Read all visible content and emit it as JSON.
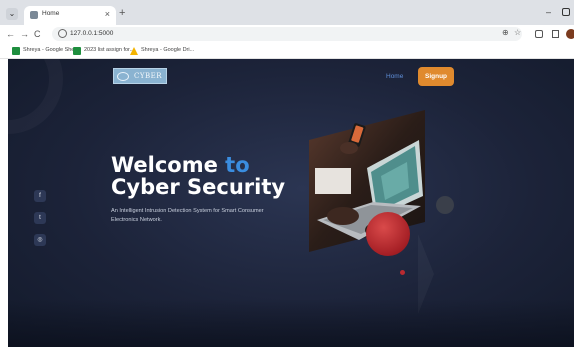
{
  "browser": {
    "tab_title": "Home",
    "tab_close": "×",
    "new_tab": "+",
    "minimize": "–",
    "url": "127.0.0.1:5000",
    "back": "←",
    "forward": "→",
    "reload": "C",
    "zoom": "⊕",
    "star": "☆",
    "bookmarks": [
      {
        "label": "Shreya - Google She...",
        "icon_color": "#1e8e3e"
      },
      {
        "label": "2023 list assign for...",
        "icon_color": "#1e8e3e"
      },
      {
        "label": "Shreya - Google Dri...",
        "icon_color": "#f4b400"
      }
    ]
  },
  "site": {
    "logo_text": "CYBER",
    "nav": {
      "home": "Home",
      "signup": "Signup"
    },
    "social": {
      "facebook": "f",
      "twitter": "t",
      "instagram": "◎"
    },
    "hero": {
      "title_part1": "Welcome ",
      "title_accent": "to",
      "title_part2": " Cyber Security",
      "description": "An Intelligent Intrusion Detection System for Smart Consumer Electronics Network."
    }
  },
  "colors": {
    "background": "#1c2339",
    "accent_blue": "#3a8de0",
    "signup_orange": "#e08a2e",
    "deco_red": "#a51f25"
  }
}
